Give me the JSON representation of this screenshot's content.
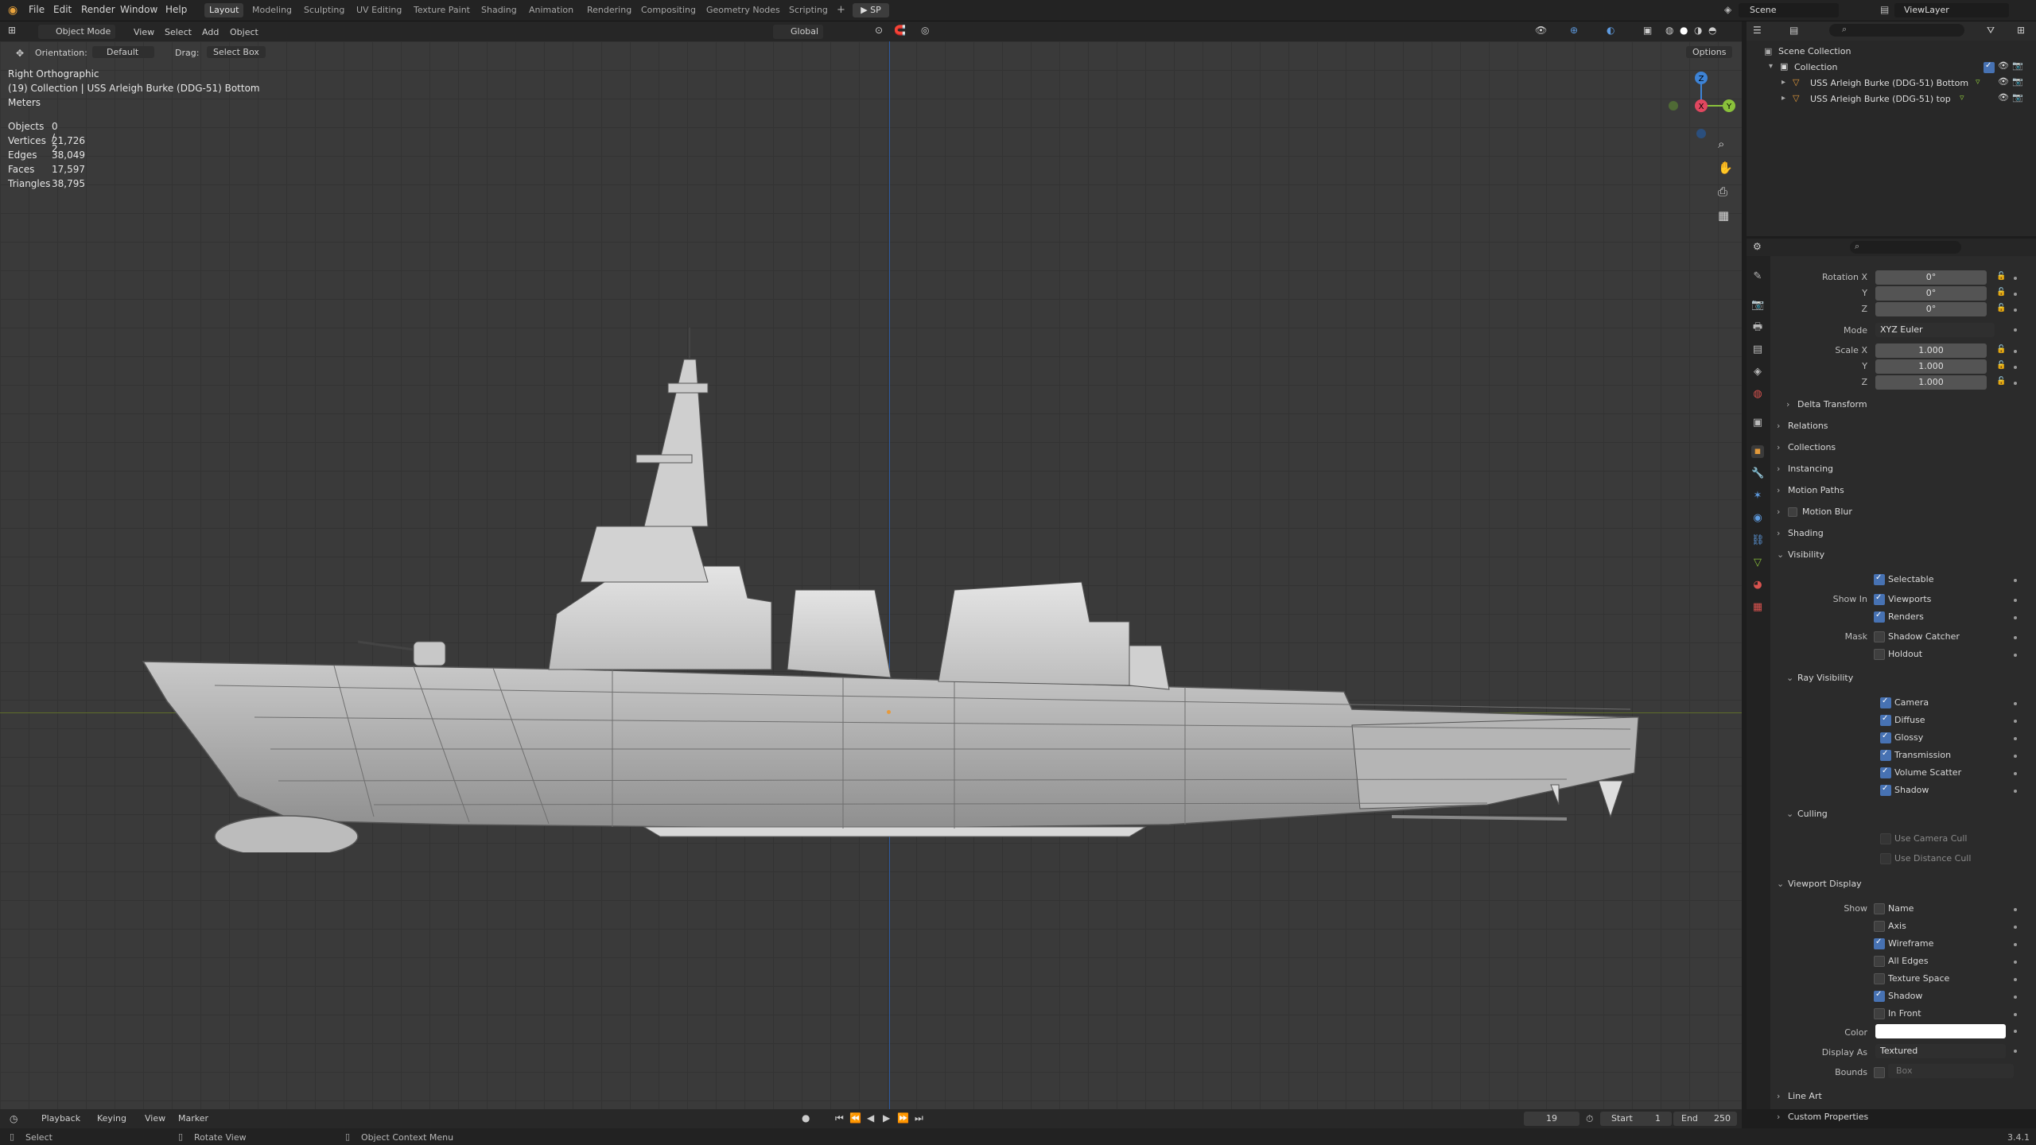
{
  "topbar": {
    "menu": [
      "File",
      "Edit",
      "Render",
      "Window",
      "Help"
    ],
    "workspaces": [
      "Layout",
      "Modeling",
      "Sculpting",
      "UV Editing",
      "Texture Paint",
      "Shading",
      "Animation",
      "Rendering",
      "Compositing",
      "Geometry Nodes",
      "Scripting"
    ],
    "active_workspace": "Layout",
    "run_script_label": "SP",
    "scene_name": "Scene",
    "view_layer": "ViewLayer"
  },
  "viewport_header": {
    "mode": "Object Mode",
    "menus": [
      "View",
      "Select",
      "Add",
      "Object"
    ],
    "transform_orientation": "Global",
    "orientation_label": "Orientation:",
    "orientation_value": "Default",
    "drag_label": "Drag:",
    "drag_value": "Select Box",
    "options_label": "Options"
  },
  "viewport_overlay": {
    "view_name": "Right Orthographic",
    "collection_info": "(19) Collection | USS Arleigh Burke (DDG-51) Bottom",
    "units": "Meters",
    "stats": [
      {
        "label": "Objects",
        "value": "0 / 2"
      },
      {
        "label": "Vertices",
        "value": "21,726"
      },
      {
        "label": "Edges",
        "value": "38,049"
      },
      {
        "label": "Faces",
        "value": "17,597"
      },
      {
        "label": "Triangles",
        "value": "38,795"
      }
    ],
    "gizmo_axes": {
      "z": "Z",
      "x": "X",
      "y": "Y"
    }
  },
  "outliner": {
    "root": "Scene Collection",
    "collection": "Collection",
    "objects": [
      "USS Arleigh Burke (DDG-51) Bottom",
      "USS Arleigh Burke (DDG-51) top"
    ]
  },
  "properties": {
    "rotation": {
      "label_x": "Rotation X",
      "label_y": "Y",
      "label_z": "Z",
      "x": "0°",
      "y": "0°",
      "z": "0°"
    },
    "mode": {
      "label": "Mode",
      "value": "XYZ Euler"
    },
    "scale": {
      "label_x": "Scale X",
      "label_y": "Y",
      "label_z": "Z",
      "x": "1.000",
      "y": "1.000",
      "z": "1.000"
    },
    "collapsed_sections": [
      "Delta Transform",
      "Relations",
      "Collections",
      "Instancing",
      "Motion Paths",
      "Motion Blur",
      "Shading"
    ],
    "visibility": {
      "title": "Visibility",
      "selectable": "Selectable",
      "show_in_label": "Show In",
      "viewports": "Viewports",
      "renders": "Renders",
      "mask_label": "Mask",
      "shadow_catcher": "Shadow Catcher",
      "holdout": "Holdout"
    },
    "ray_visibility": {
      "title": "Ray Visibility",
      "items": [
        "Camera",
        "Diffuse",
        "Glossy",
        "Transmission",
        "Volume Scatter",
        "Shadow"
      ]
    },
    "culling": {
      "title": "Culling",
      "items": [
        "Use Camera Cull",
        "Use Distance Cull"
      ]
    },
    "viewport_display": {
      "title": "Viewport Display",
      "show_label": "Show",
      "items": [
        {
          "label": "Name",
          "checked": false
        },
        {
          "label": "Axis",
          "checked": false
        },
        {
          "label": "Wireframe",
          "checked": true
        },
        {
          "label": "All Edges",
          "checked": false
        },
        {
          "label": "Texture Space",
          "checked": false
        },
        {
          "label": "Shadow",
          "checked": true
        },
        {
          "label": "In Front",
          "checked": false
        }
      ],
      "color_label": "Color",
      "color_value": "#ffffff",
      "display_as_label": "Display As",
      "display_as_value": "Textured",
      "bounds_label": "Bounds",
      "bounds_value": "Box"
    },
    "tail_sections": [
      "Line Art",
      "Custom Properties"
    ]
  },
  "timeline": {
    "menus": [
      "Playback",
      "Keying",
      "View",
      "Marker"
    ],
    "current_frame": "19",
    "start_label": "Start",
    "start": "1",
    "end_label": "End",
    "end": "250"
  },
  "statusbar": {
    "select": "Select",
    "rotate": "Rotate View",
    "context": "Object Context Menu",
    "version": "3.4.1"
  },
  "colors": {
    "accent": "#4772b3",
    "axis_x": "#e0475f",
    "axis_y": "#8ac13b",
    "axis_z": "#3d83d6",
    "grid_bg": "#3a3a3a"
  }
}
